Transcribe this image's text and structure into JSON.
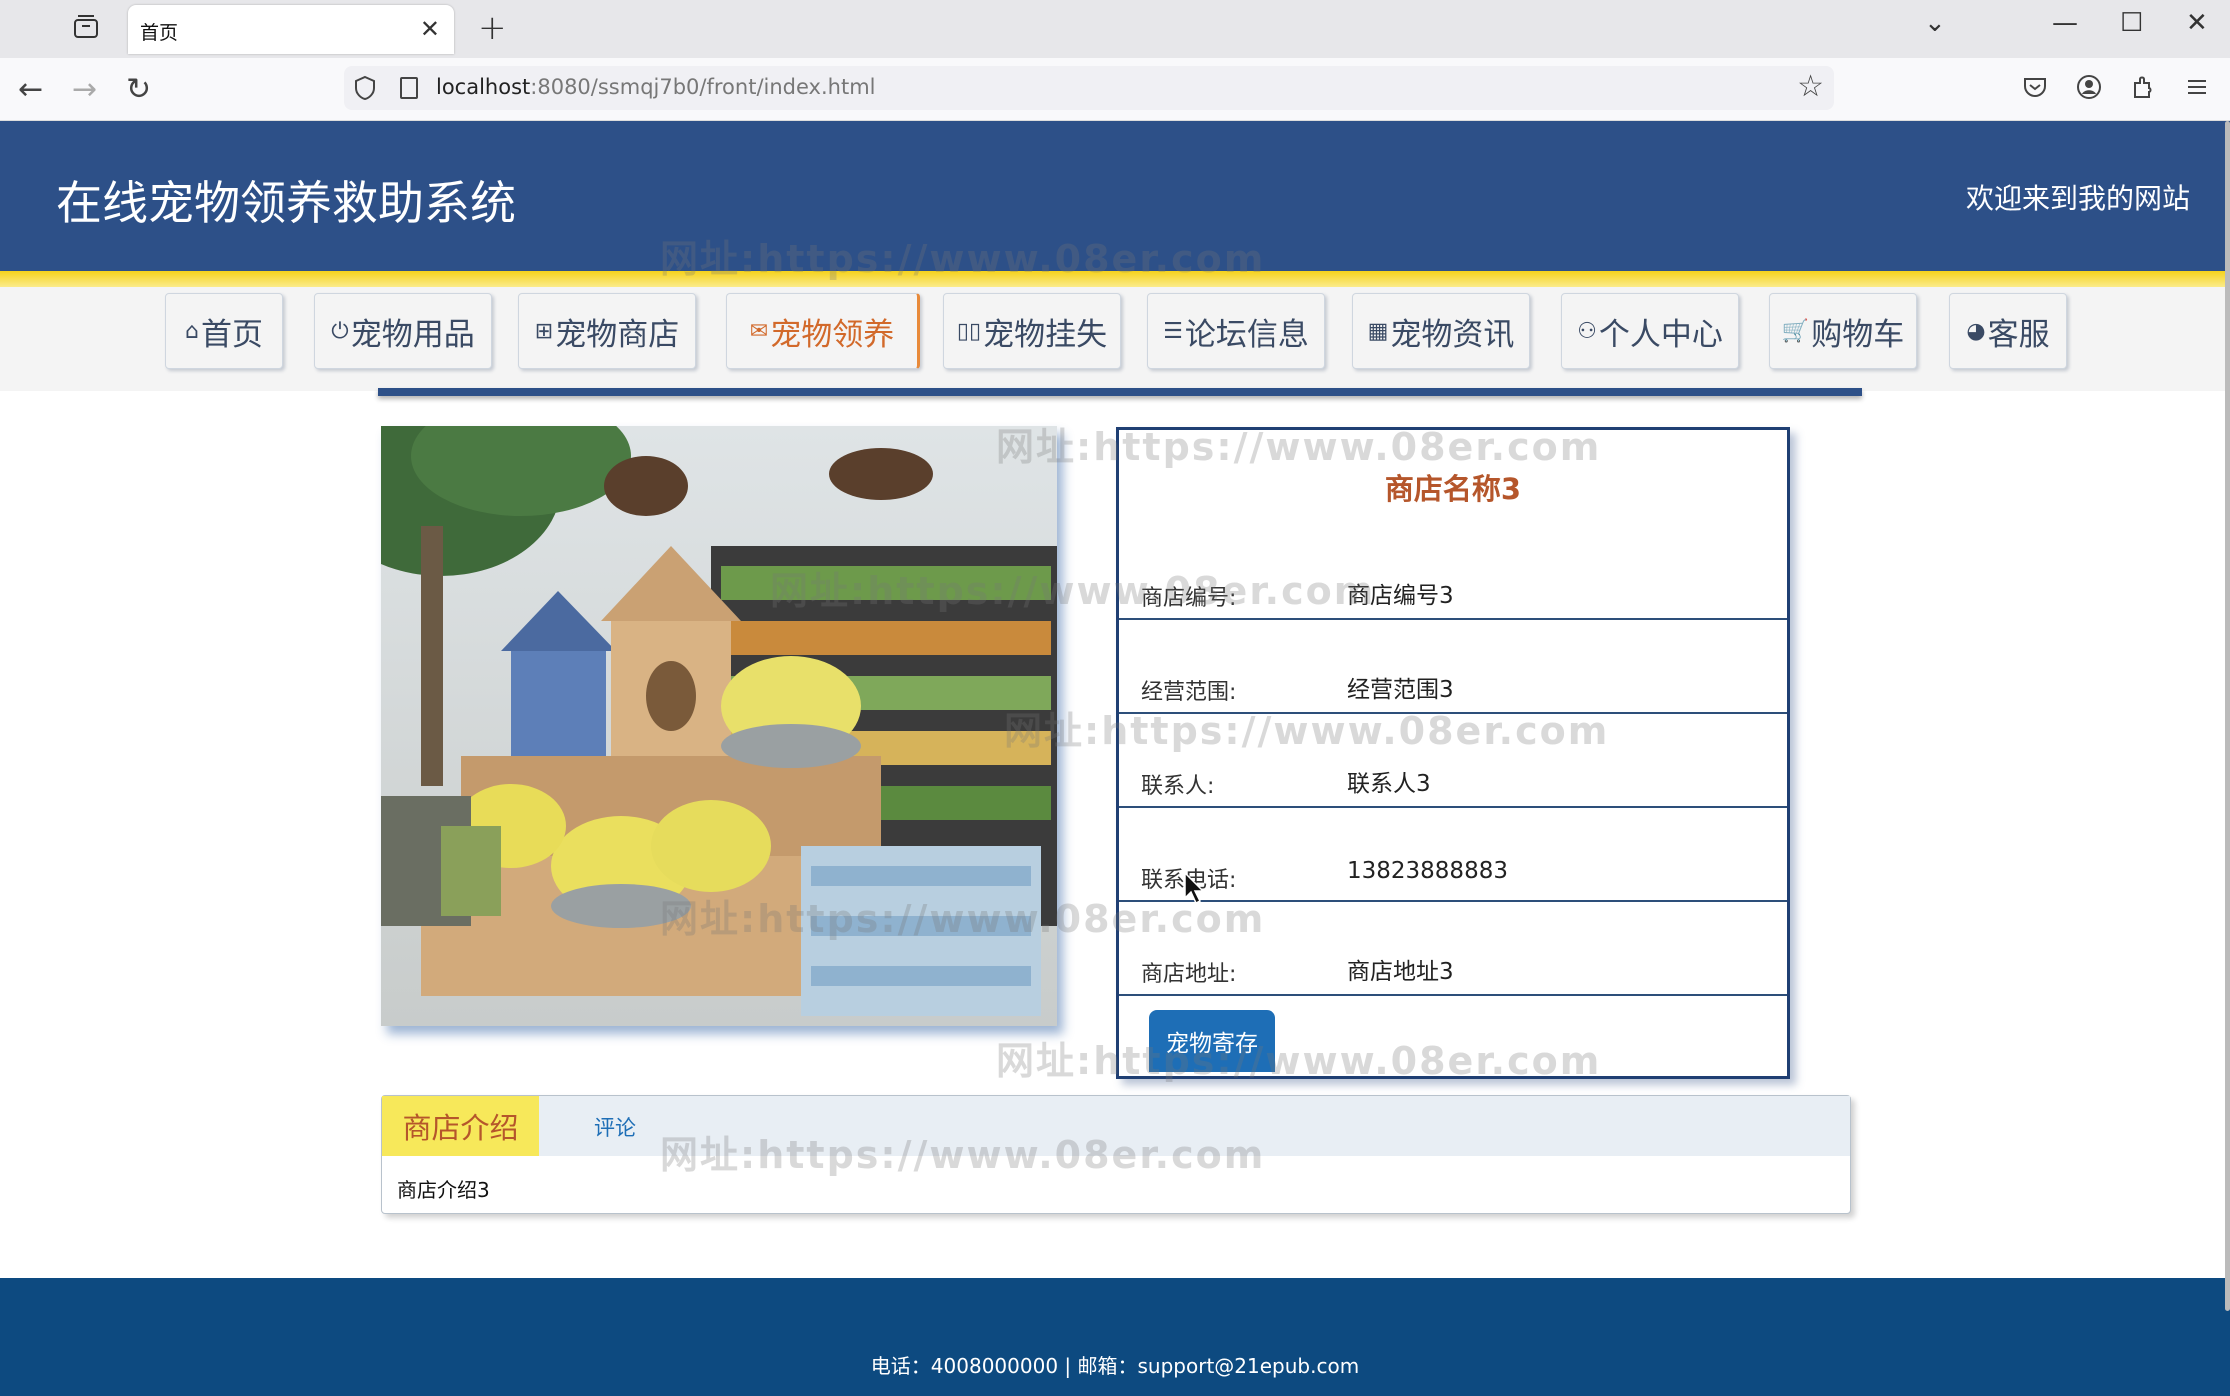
{
  "browser": {
    "tab_title": "首页",
    "url_host": "localhost",
    "url_rest": ":8080/ssmqj7b0/front/index.html"
  },
  "site": {
    "title": "在线宠物领养救助系统",
    "welcome": "欢迎来到我的网站"
  },
  "menu": [
    {
      "icon": "⌂",
      "label": "首页"
    },
    {
      "icon": "⏻",
      "label": "宠物用品"
    },
    {
      "icon": "⊞",
      "label": "宠物商店"
    },
    {
      "icon": "✉",
      "label": "宠物领养"
    },
    {
      "icon": "▯▯",
      "label": "宠物挂失"
    },
    {
      "icon": "☰",
      "label": "论坛信息"
    },
    {
      "icon": "▦",
      "label": "宠物资讯"
    },
    {
      "icon": "⚇",
      "label": "个人中心"
    },
    {
      "icon": "🛒",
      "label": "购物车"
    },
    {
      "icon": "◕",
      "label": "客服"
    }
  ],
  "shop": {
    "name": "商店名称3",
    "fields": [
      {
        "label": "商店编号:",
        "value": "商店编号3"
      },
      {
        "label": "经营范围:",
        "value": "经营范围3"
      },
      {
        "label": "联系人:",
        "value": "联系人3"
      },
      {
        "label": "联系电话:",
        "value": "13823888883"
      },
      {
        "label": "商店地址:",
        "value": "商店地址3"
      }
    ],
    "action": "宠物寄存"
  },
  "tabs": {
    "intro_label": "商店介绍",
    "comment_label": "评论",
    "intro_text": "商店介绍3"
  },
  "footer": {
    "text": "电话：4008000000 | 邮箱：support@21epub.com"
  },
  "watermark": "网址:https://www.08er.com"
}
